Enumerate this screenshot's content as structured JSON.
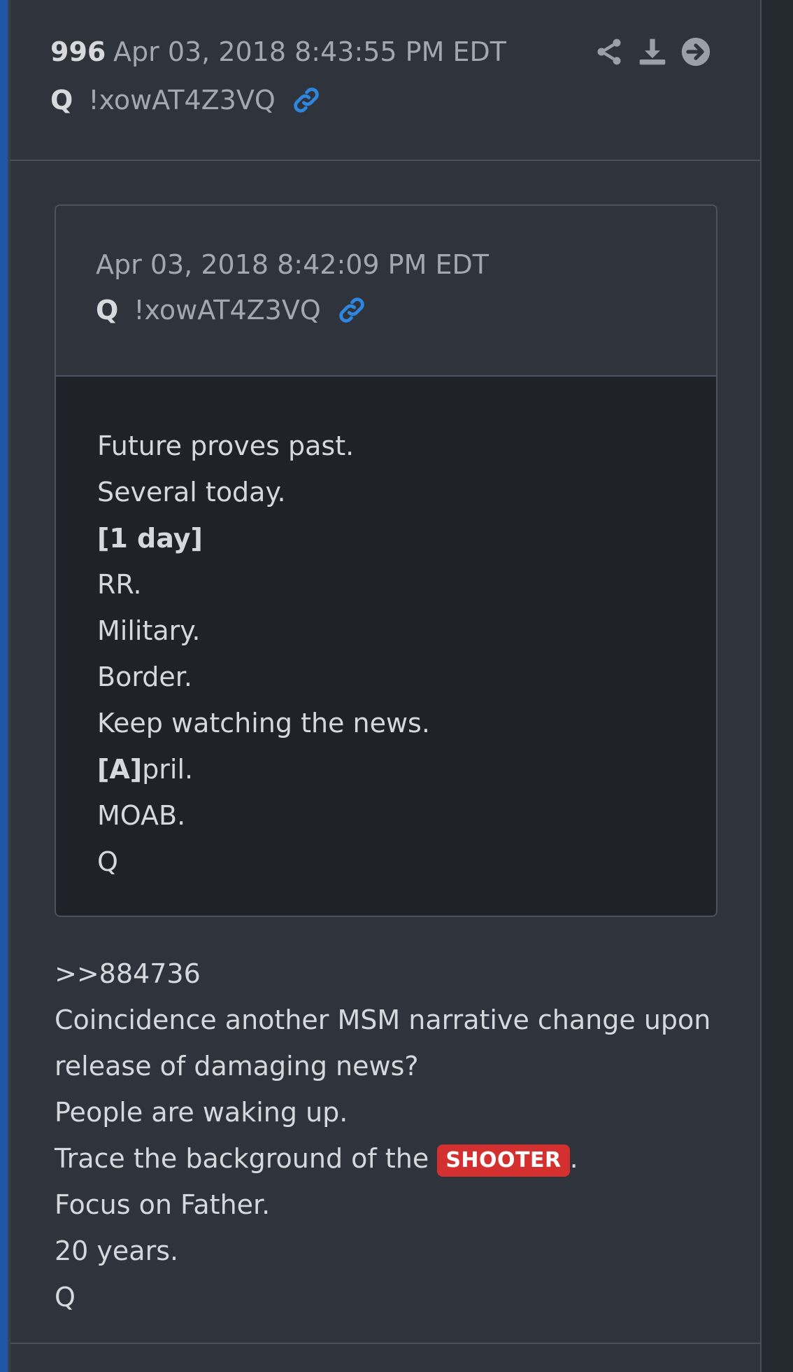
{
  "post": {
    "number": "996",
    "date": "Apr 03, 2018 8:43:55 PM EDT",
    "author": "Q",
    "tripcode": "!xowAT4Z3VQ",
    "actions": [
      {
        "name": "share-icon"
      },
      {
        "name": "download-icon"
      },
      {
        "name": "arrow-right-circle-icon"
      }
    ]
  },
  "quote": {
    "date": "Apr 03, 2018 8:42:09 PM EDT",
    "author": "Q",
    "tripcode": "!xowAT4Z3VQ",
    "lines": [
      "Future proves past.",
      "Several today.",
      "[1 day]",
      "RR.",
      "Military.",
      "Border.",
      "Keep watching the news.",
      "[A]",
      "pril.",
      "MOAB.",
      "Q"
    ]
  },
  "body": {
    "reference": ">>884736",
    "line1": "Coincidence another MSM narrative change upon",
    "line2": "release of damaging news?",
    "line3": "People are waking up.",
    "line4_prefix": "Trace the background of the ",
    "badge": "SHOOTER",
    "line4_suffix": ".",
    "line5": "Focus on Father.",
    "line6": "20 years.",
    "line7": "Q"
  },
  "colors": {
    "link": "#2e86de",
    "badge": "#d3302f"
  }
}
